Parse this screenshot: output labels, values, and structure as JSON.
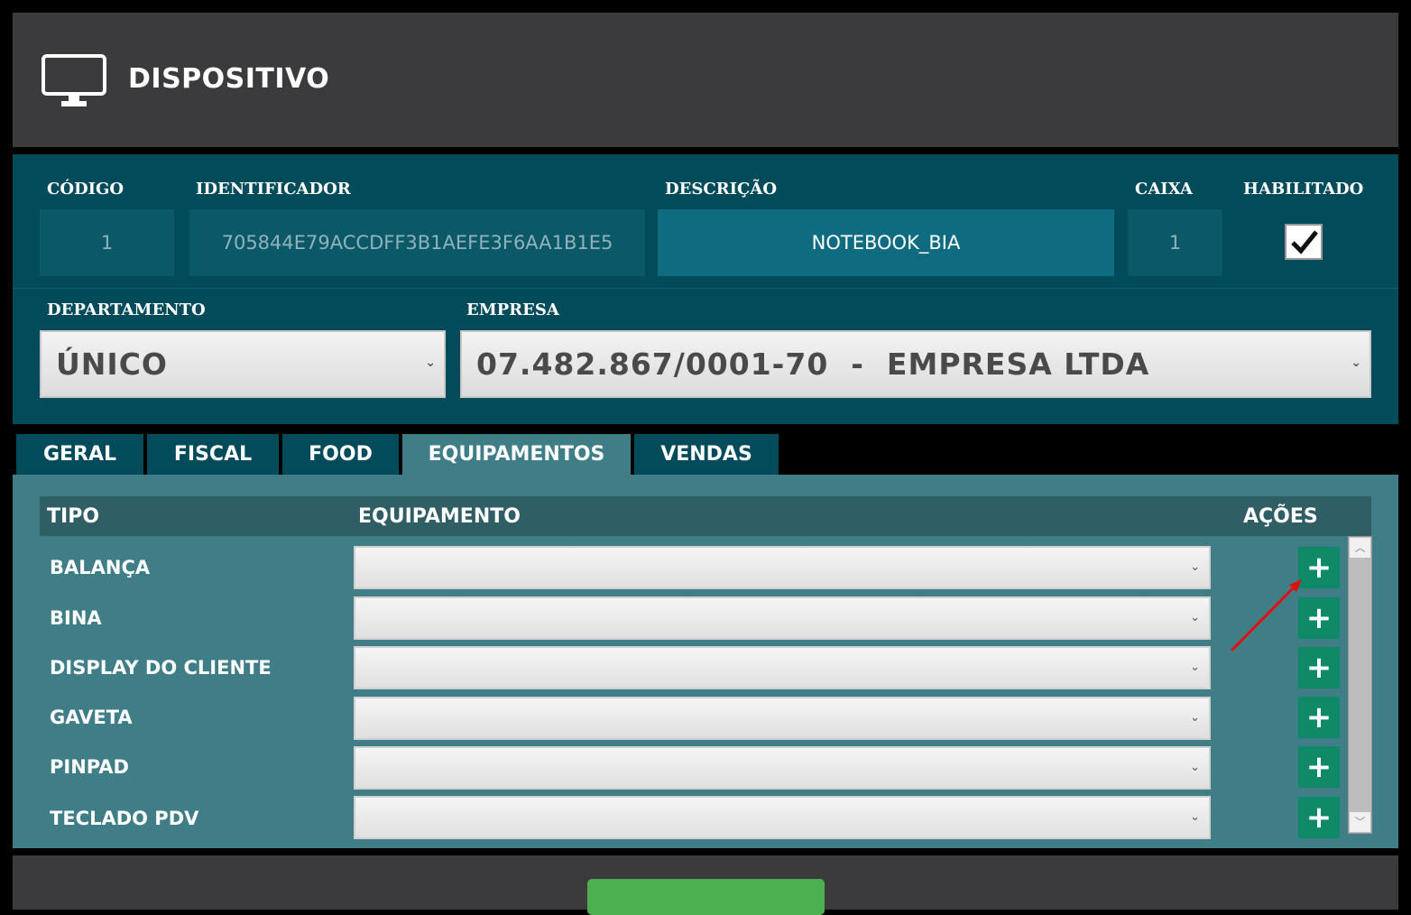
{
  "header": {
    "title": "DISPOSITIVO",
    "icon": "monitor-icon"
  },
  "form": {
    "labels": {
      "codigo": "CÓDIGO",
      "identificador": "IDENTIFICADOR",
      "descricao": "DESCRIÇÃO",
      "caixa": "CAIXA",
      "habilitado": "HABILITADO",
      "departamento": "DEPARTAMENTO",
      "empresa": "EMPRESA"
    },
    "values": {
      "codigo": "1",
      "identificador": "705844E79ACCDFF3B1AEFE3F6AA1B1E5",
      "descricao": "NOTEBOOK_BIA",
      "caixa": "1",
      "habilitado": true,
      "departamento": "ÚNICO",
      "empresa": "07.482.867/0001-70  -  EMPRESA LTDA"
    }
  },
  "tabs": [
    {
      "label": "GERAL"
    },
    {
      "label": "FISCAL"
    },
    {
      "label": "FOOD"
    },
    {
      "label": "EQUIPAMENTOS",
      "active": true
    },
    {
      "label": "VENDAS"
    }
  ],
  "table": {
    "headers": {
      "tipo": "TIPO",
      "equipamento": "EQUIPAMENTO",
      "acoes": "AÇÕES"
    },
    "rows": [
      {
        "tipo": "BALANÇA",
        "equipamento": ""
      },
      {
        "tipo": "BINA",
        "equipamento": ""
      },
      {
        "tipo": "DISPLAY DO CLIENTE",
        "equipamento": ""
      },
      {
        "tipo": "GAVETA",
        "equipamento": ""
      },
      {
        "tipo": "PINPAD",
        "equipamento": ""
      },
      {
        "tipo": "TECLADO PDV",
        "equipamento": ""
      }
    ],
    "add_symbol": "+"
  },
  "colors": {
    "header_bg": "#3b3b3d",
    "form_bg": "#014b5a",
    "panel_bg": "#3f7e87",
    "add_button": "#0e8a66",
    "save_button": "#4caf50"
  }
}
